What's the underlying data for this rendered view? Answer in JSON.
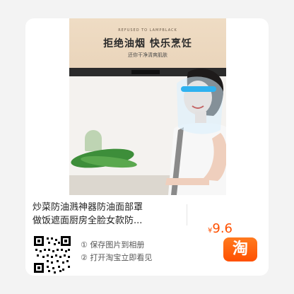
{
  "banner": {
    "top_text": "REFUSED TO LAMPBLACK",
    "title": "拒绝油烟 快乐烹饪",
    "subtitle": "还你干净清爽肌肤"
  },
  "product": {
    "title_line1": "炒菜防油溅神器防油面部罩",
    "title_line2": "做饭遮面厨房全脸女款防...",
    "price_symbol": "¥",
    "price_value": "9.6"
  },
  "hints": {
    "step1": "① 保存图片到相册",
    "step2": "② 打开淘宝立即看见"
  },
  "app_icon": {
    "label": "淘",
    "icon": "taobao-icon",
    "color": "#ff5000"
  },
  "colors": {
    "accent": "#ff5000",
    "background": "#f3f3f3",
    "card": "#ffffff"
  }
}
